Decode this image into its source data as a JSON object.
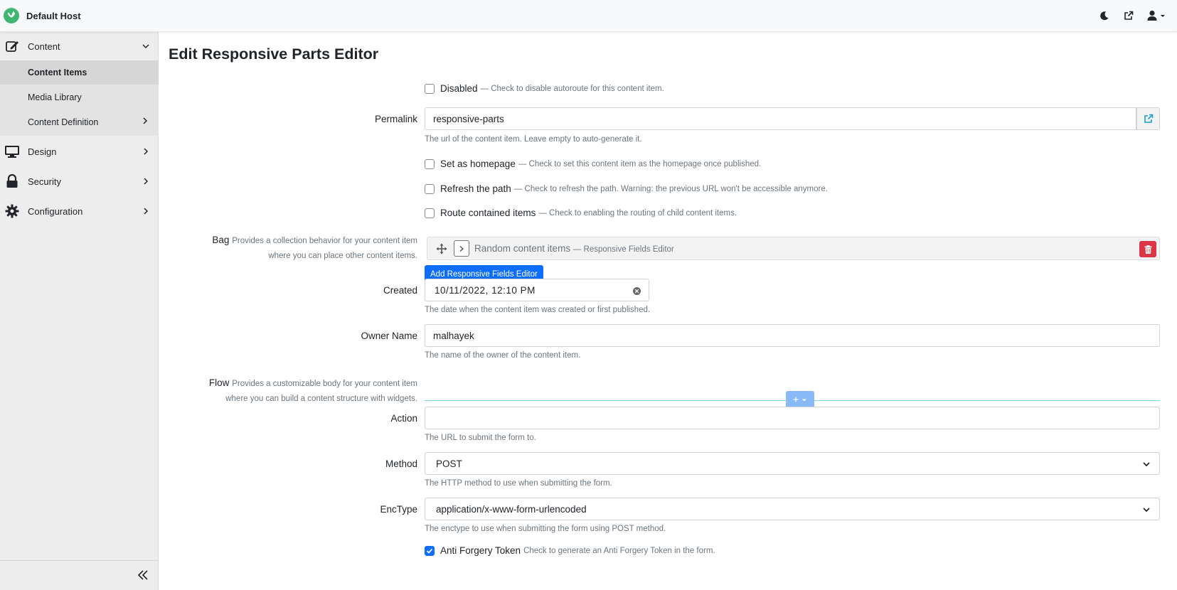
{
  "topbar": {
    "title": "Default Host",
    "icons": [
      "logo-icon",
      "moon-icon",
      "external-link-icon",
      "user-icon",
      "caret-down-icon"
    ]
  },
  "sidebar": {
    "content": {
      "label": "Content",
      "icon": "edit-icon"
    },
    "content_items": {
      "label": "Content Items"
    },
    "media_library": {
      "label": "Media Library"
    },
    "content_definition": {
      "label": "Content Definition"
    },
    "design": {
      "label": "Design",
      "icon": "monitor-icon"
    },
    "security": {
      "label": "Security",
      "icon": "lock-icon"
    },
    "configuration": {
      "label": "Configuration",
      "icon": "gear-icon"
    }
  },
  "main": {
    "title": "Edit Responsive Parts Editor",
    "disabled": {
      "label": "Disabled",
      "desc": "— Check to disable autoroute for this content item.",
      "checked": false
    },
    "permalink": {
      "label": "Permalink",
      "value": "responsive-parts",
      "hint": "The url of the content item. Leave empty to auto-generate it."
    },
    "homepage": {
      "label": "Set as homepage",
      "desc": "— Check to set this content item as the homepage once published.",
      "checked": false
    },
    "refresh": {
      "label": "Refresh the path",
      "desc": "— Check to refresh the path. Warning: the previous URL won't be accessible anymore.",
      "checked": false
    },
    "route_contained": {
      "label": "Route contained items",
      "desc": "— Check to enabling the routing of child content items.",
      "checked": false
    },
    "bag": {
      "label": "Bag",
      "note_line1": "Provides a collection behavior for your content item",
      "note_line2": "where you can place other content items.",
      "item_title": "Random content items",
      "item_type": "— Responsive Fields Editor",
      "add_button": "Add Responsive Fields Editor"
    },
    "created": {
      "label": "Created",
      "value": "10/11/2022, 12:10 PM",
      "hint": "The date when the content item was created or first published."
    },
    "owner": {
      "label": "Owner Name",
      "value": "malhayek",
      "hint": "The name of the owner of the content item."
    },
    "flow": {
      "label": "Flow",
      "note_line1": "Provides a customizable body for your content item",
      "note_line2": "where you can build a content structure with widgets.",
      "add_symbol": "+"
    },
    "action": {
      "label": "Action",
      "value": "",
      "hint": "The URL to submit the form to."
    },
    "method": {
      "label": "Method",
      "value": "POST",
      "hint": "The HTTP method to use when submitting the form."
    },
    "enctype": {
      "label": "EncType",
      "value": "application/x-www-form-urlencoded",
      "hint": "The enctype to use when submitting the form using POST method."
    },
    "antiforgery": {
      "label": "Anti Forgery Token",
      "desc": "Check to generate an Anti Forgery Token in the form.",
      "checked": true
    }
  }
}
